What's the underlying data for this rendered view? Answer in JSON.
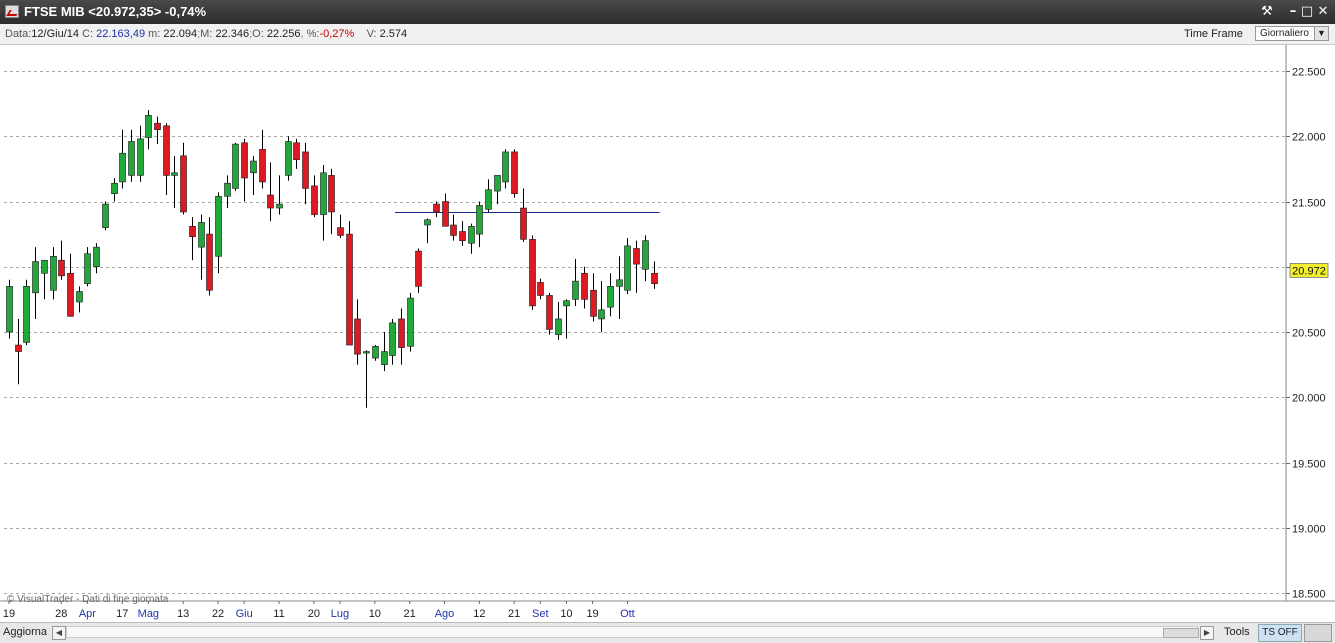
{
  "window": {
    "title": "FTSE MIB <20.972,35>  -0,74%",
    "tools_glyph": "⚒",
    "minimize_glyph": "–",
    "maximize_glyph": "□",
    "close_glyph": "✕"
  },
  "infobar": {
    "data_label": "Data:",
    "data_value": "12/Giu/14",
    "c_label": "C:",
    "c_value": "22.163,49",
    "m_label": "m:",
    "m_value": "22.094",
    "M_label": "M:",
    "M_value": "22.346",
    "o_label": "O:",
    "o_value": "22.256",
    "pct_label": "%:",
    "pct_value": "-0,27%",
    "v_label": "V:",
    "v_value": "2.574",
    "time_frame_label": "Time Frame",
    "time_frame_value": "Giornaliero"
  },
  "watermark": "© VisualTrader - Dati di fine giornata",
  "bottombar": {
    "aggiorna_label": "Aggiorna",
    "tools_label": "Tools",
    "tsoff_label": "TS OFF"
  },
  "colors": {
    "up": "#22a83a",
    "down": "#dd1a22",
    "wick": "#000000",
    "grid": "#aaaaaa",
    "resistance_line": "#1b2a8a",
    "last_price_bg": "#f3f02b"
  },
  "chart_data": {
    "type": "candlestick",
    "ylim": [
      18450,
      22600
    ],
    "y_ticks": [
      "18.500",
      "19.000",
      "19.500",
      "20.000",
      "20.500",
      "21.000",
      "21.500",
      "22.000",
      "22.500"
    ],
    "y_tick_values": [
      18500,
      19000,
      19500,
      20000,
      20500,
      21000,
      21500,
      22000,
      22500
    ],
    "last_price_label": "20.972",
    "last_price": 20972,
    "x_tick_labels": [
      "19",
      "28",
      "Apr",
      "17",
      "Mag",
      "13",
      "22",
      "Giu",
      "11",
      "20",
      "Lug",
      "10",
      "21",
      "Ago",
      "12",
      "21",
      "Set",
      "10",
      "19",
      "Ott"
    ],
    "x_tick_is_month": [
      false,
      false,
      true,
      false,
      true,
      false,
      false,
      true,
      false,
      false,
      true,
      false,
      false,
      true,
      false,
      false,
      true,
      false,
      false,
      true
    ],
    "x_tick_index": [
      0,
      6,
      9,
      13,
      16,
      20,
      24,
      27,
      31,
      35,
      38,
      42,
      46,
      50,
      54,
      58,
      61,
      64,
      67,
      71
    ],
    "resistance_level": 21420,
    "resistance_from_index": 45,
    "resistance_to_index": 74,
    "candles": [
      {
        "o": 20500,
        "h": 20900,
        "l": 20450,
        "c": 20850
      },
      {
        "o": 20400,
        "h": 20600,
        "l": 20100,
        "c": 20350
      },
      {
        "o": 20420,
        "h": 20900,
        "l": 20400,
        "c": 20850
      },
      {
        "o": 20800,
        "h": 21150,
        "l": 20600,
        "c": 21040
      },
      {
        "o": 20950,
        "h": 21050,
        "l": 20750,
        "c": 21050
      },
      {
        "o": 20820,
        "h": 21150,
        "l": 20750,
        "c": 21080
      },
      {
        "o": 21050,
        "h": 21200,
        "l": 20900,
        "c": 20930
      },
      {
        "o": 20950,
        "h": 21100,
        "l": 20620,
        "c": 20620
      },
      {
        "o": 20730,
        "h": 20850,
        "l": 20650,
        "c": 20810
      },
      {
        "o": 20870,
        "h": 21150,
        "l": 20850,
        "c": 21100
      },
      {
        "o": 21000,
        "h": 21180,
        "l": 20950,
        "c": 21150
      },
      {
        "o": 21300,
        "h": 21500,
        "l": 21280,
        "c": 21480
      },
      {
        "o": 21560,
        "h": 21680,
        "l": 21500,
        "c": 21640
      },
      {
        "o": 21650,
        "h": 22050,
        "l": 21600,
        "c": 21870
      },
      {
        "o": 21700,
        "h": 22050,
        "l": 21650,
        "c": 21960
      },
      {
        "o": 21700,
        "h": 22080,
        "l": 21650,
        "c": 21980
      },
      {
        "o": 21990,
        "h": 22200,
        "l": 21900,
        "c": 22160
      },
      {
        "o": 22100,
        "h": 22150,
        "l": 21940,
        "c": 22050
      },
      {
        "o": 22080,
        "h": 22100,
        "l": 21550,
        "c": 21700
      },
      {
        "o": 21700,
        "h": 21850,
        "l": 21450,
        "c": 21720
      },
      {
        "o": 21850,
        "h": 21950,
        "l": 21400,
        "c": 21420
      },
      {
        "o": 21310,
        "h": 21380,
        "l": 21050,
        "c": 21230
      },
      {
        "o": 21150,
        "h": 21400,
        "l": 20900,
        "c": 21340
      },
      {
        "o": 21250,
        "h": 21380,
        "l": 20780,
        "c": 20820
      },
      {
        "o": 21080,
        "h": 21570,
        "l": 20950,
        "c": 21540
      },
      {
        "o": 21540,
        "h": 21700,
        "l": 21450,
        "c": 21640
      },
      {
        "o": 21600,
        "h": 21950,
        "l": 21580,
        "c": 21940
      },
      {
        "o": 21950,
        "h": 21980,
        "l": 21500,
        "c": 21680
      },
      {
        "o": 21720,
        "h": 21850,
        "l": 21550,
        "c": 21810
      },
      {
        "o": 21900,
        "h": 22050,
        "l": 21600,
        "c": 21650
      },
      {
        "o": 21550,
        "h": 21800,
        "l": 21350,
        "c": 21450
      },
      {
        "o": 21450,
        "h": 21700,
        "l": 21400,
        "c": 21480
      },
      {
        "o": 21700,
        "h": 22000,
        "l": 21660,
        "c": 21960
      },
      {
        "o": 21950,
        "h": 21980,
        "l": 21750,
        "c": 21820
      },
      {
        "o": 21880,
        "h": 21950,
        "l": 21480,
        "c": 21600
      },
      {
        "o": 21620,
        "h": 21700,
        "l": 21380,
        "c": 21400
      },
      {
        "o": 21400,
        "h": 21780,
        "l": 21200,
        "c": 21720
      },
      {
        "o": 21700,
        "h": 21750,
        "l": 21250,
        "c": 21420
      },
      {
        "o": 21300,
        "h": 21400,
        "l": 21220,
        "c": 21240
      },
      {
        "o": 21250,
        "h": 21350,
        "l": 20400,
        "c": 20400
      },
      {
        "o": 20600,
        "h": 20750,
        "l": 20250,
        "c": 20330
      },
      {
        "o": 20350,
        "h": 20360,
        "l": 19920,
        "c": 20350
      },
      {
        "o": 20300,
        "h": 20400,
        "l": 20280,
        "c": 20390
      },
      {
        "o": 20250,
        "h": 20500,
        "l": 20200,
        "c": 20350
      },
      {
        "o": 20320,
        "h": 20600,
        "l": 20250,
        "c": 20570
      },
      {
        "o": 20600,
        "h": 20680,
        "l": 20250,
        "c": 20380
      },
      {
        "o": 20390,
        "h": 20800,
        "l": 20350,
        "c": 20760
      },
      {
        "o": 21120,
        "h": 21140,
        "l": 20800,
        "c": 20850
      },
      {
        "o": 21320,
        "h": 21370,
        "l": 21180,
        "c": 21360
      },
      {
        "o": 21480,
        "h": 21500,
        "l": 21380,
        "c": 21420
      },
      {
        "o": 21500,
        "h": 21560,
        "l": 21310,
        "c": 21310
      },
      {
        "o": 21320,
        "h": 21400,
        "l": 21200,
        "c": 21240
      },
      {
        "o": 21270,
        "h": 21350,
        "l": 21160,
        "c": 21200
      },
      {
        "o": 21180,
        "h": 21330,
        "l": 21100,
        "c": 21310
      },
      {
        "o": 21250,
        "h": 21500,
        "l": 21150,
        "c": 21470
      },
      {
        "o": 21440,
        "h": 21670,
        "l": 21420,
        "c": 21590
      },
      {
        "o": 21580,
        "h": 21700,
        "l": 21480,
        "c": 21700
      },
      {
        "o": 21650,
        "h": 21900,
        "l": 21600,
        "c": 21880
      },
      {
        "o": 21880,
        "h": 21900,
        "l": 21530,
        "c": 21560
      },
      {
        "o": 21450,
        "h": 21600,
        "l": 21190,
        "c": 21210
      },
      {
        "o": 21210,
        "h": 21240,
        "l": 20670,
        "c": 20700
      },
      {
        "o": 20880,
        "h": 20910,
        "l": 20750,
        "c": 20780
      },
      {
        "o": 20780,
        "h": 20800,
        "l": 20480,
        "c": 20520
      },
      {
        "o": 20480,
        "h": 20730,
        "l": 20440,
        "c": 20600
      },
      {
        "o": 20700,
        "h": 20750,
        "l": 20450,
        "c": 20740
      },
      {
        "o": 20750,
        "h": 21060,
        "l": 20700,
        "c": 20890
      },
      {
        "o": 20950,
        "h": 21000,
        "l": 20680,
        "c": 20750
      },
      {
        "o": 20820,
        "h": 20950,
        "l": 20580,
        "c": 20620
      },
      {
        "o": 20600,
        "h": 20890,
        "l": 20500,
        "c": 20670
      },
      {
        "o": 20690,
        "h": 20950,
        "l": 20620,
        "c": 20850
      },
      {
        "o": 20850,
        "h": 21080,
        "l": 20600,
        "c": 20900
      },
      {
        "o": 20820,
        "h": 21220,
        "l": 20790,
        "c": 21160
      },
      {
        "o": 21140,
        "h": 21200,
        "l": 20800,
        "c": 21020
      },
      {
        "o": 20980,
        "h": 21240,
        "l": 20890,
        "c": 21200
      },
      {
        "o": 20950,
        "h": 21040,
        "l": 20830,
        "c": 20870
      }
    ]
  }
}
